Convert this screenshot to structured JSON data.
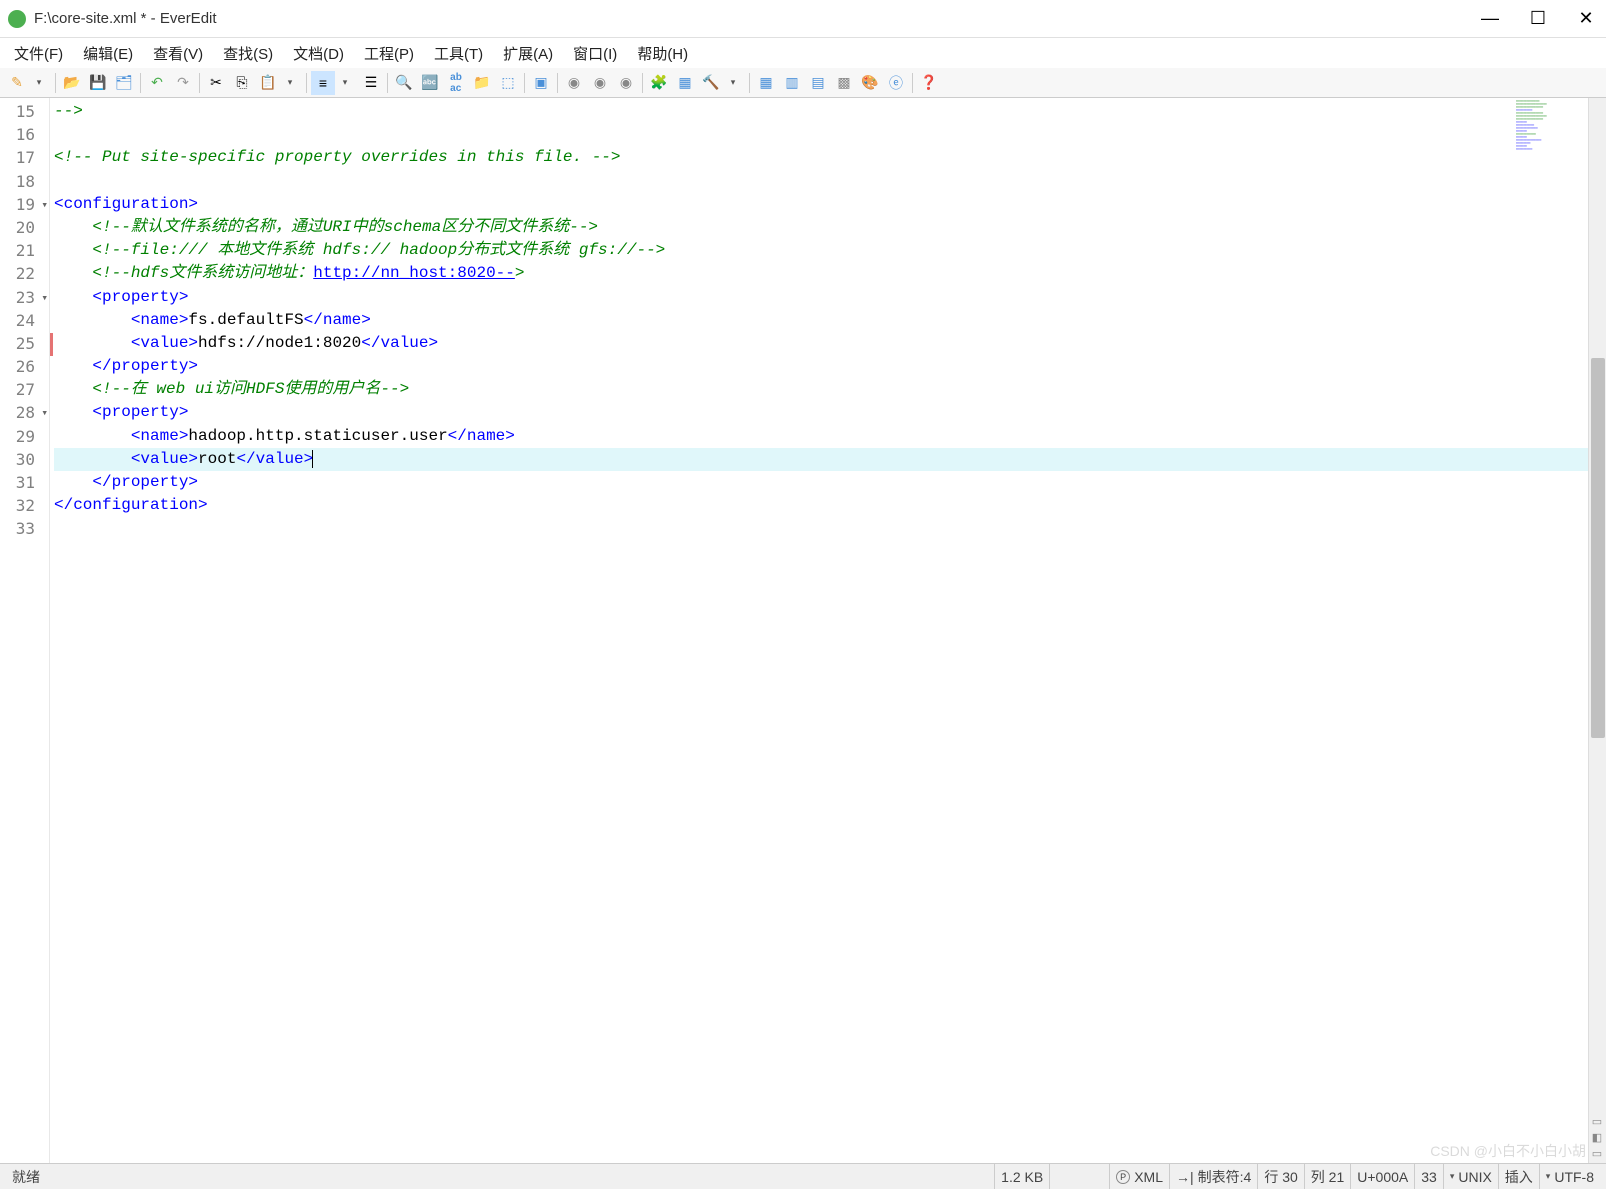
{
  "window": {
    "title": "F:\\core-site.xml * - EverEdit",
    "appname": "EverEdit"
  },
  "menu": {
    "items": [
      "文件(F)",
      "编辑(E)",
      "查看(V)",
      "查找(S)",
      "文档(D)",
      "工程(P)",
      "工具(T)",
      "扩展(A)",
      "窗口(I)",
      "帮助(H)"
    ]
  },
  "code": {
    "lines": [
      {
        "n": 15,
        "segs": [
          {
            "t": "-->",
            "c": "c-cmt"
          }
        ]
      },
      {
        "n": 16,
        "segs": []
      },
      {
        "n": 17,
        "segs": [
          {
            "t": "<!-- Put site-specific property overrides in this file. -->",
            "c": "c-cmt"
          }
        ]
      },
      {
        "n": 18,
        "segs": []
      },
      {
        "n": 19,
        "fold": true,
        "segs": [
          {
            "t": "<configuration>",
            "c": "c-tag"
          }
        ]
      },
      {
        "n": 20,
        "segs": [
          {
            "t": "    ",
            "c": ""
          },
          {
            "t": "<!--默认文件系统的名称，通过URI中的schema区分不同文件系统-->",
            "c": "c-cmt"
          }
        ]
      },
      {
        "n": 21,
        "segs": [
          {
            "t": "    ",
            "c": ""
          },
          {
            "t": "<!--file:/// 本地文件系统 hdfs:// hadoop分布式文件系统 gfs://-->",
            "c": "c-cmt"
          }
        ]
      },
      {
        "n": 22,
        "segs": [
          {
            "t": "    ",
            "c": ""
          },
          {
            "t": "<!--hdfs文件系统访问地址：",
            "c": "c-cmt"
          },
          {
            "t": "http://nn_host:8020--",
            "c": "c-lnk"
          },
          {
            "t": ">",
            "c": "c-cmt"
          }
        ]
      },
      {
        "n": 23,
        "fold": true,
        "segs": [
          {
            "t": "    ",
            "c": ""
          },
          {
            "t": "<property>",
            "c": "c-tag"
          }
        ]
      },
      {
        "n": 24,
        "segs": [
          {
            "t": "        ",
            "c": ""
          },
          {
            "t": "<name>",
            "c": "c-tag"
          },
          {
            "t": "fs.defaultFS",
            "c": "c-txt"
          },
          {
            "t": "</name>",
            "c": "c-tag"
          }
        ]
      },
      {
        "n": 25,
        "segs": [
          {
            "t": "        ",
            "c": ""
          },
          {
            "t": "<value>",
            "c": "c-tag"
          },
          {
            "t": "hdfs://node1:8020",
            "c": "c-txt"
          },
          {
            "t": "</value>",
            "c": "c-tag"
          }
        ]
      },
      {
        "n": 26,
        "segs": [
          {
            "t": "    ",
            "c": ""
          },
          {
            "t": "</property>",
            "c": "c-tag"
          }
        ]
      },
      {
        "n": 27,
        "segs": [
          {
            "t": "    ",
            "c": ""
          },
          {
            "t": "<!--在 web ui访问HDFS使用的用户名-->",
            "c": "c-cmt"
          }
        ]
      },
      {
        "n": 28,
        "fold": true,
        "segs": [
          {
            "t": "    ",
            "c": ""
          },
          {
            "t": "<property>",
            "c": "c-tag"
          }
        ]
      },
      {
        "n": 29,
        "segs": [
          {
            "t": "        ",
            "c": ""
          },
          {
            "t": "<name>",
            "c": "c-tag"
          },
          {
            "t": "hadoop.http.staticuser.user",
            "c": "c-txt"
          },
          {
            "t": "</name>",
            "c": "c-tag"
          }
        ]
      },
      {
        "n": 30,
        "hl": true,
        "caret": true,
        "segs": [
          {
            "t": "        ",
            "c": ""
          },
          {
            "t": "<value>",
            "c": "c-tag"
          },
          {
            "t": "root",
            "c": "c-txt"
          },
          {
            "t": "</value>",
            "c": "c-tag"
          }
        ]
      },
      {
        "n": 31,
        "segs": [
          {
            "t": "    ",
            "c": ""
          },
          {
            "t": "</property>",
            "c": "c-tag"
          }
        ]
      },
      {
        "n": 32,
        "segs": [
          {
            "t": "</configuration>",
            "c": "c-tag"
          }
        ]
      },
      {
        "n": 33,
        "segs": []
      }
    ]
  },
  "status": {
    "ready": "就绪",
    "size": "1.2 KB",
    "lang": "XML",
    "tab": "制表符:4",
    "line": "行 30",
    "col": "列 21",
    "uni": "U+000A",
    "sel": "33",
    "eol": "UNIX",
    "mode": "插入",
    "enc": "UTF-8"
  },
  "watermark": "CSDN @小白不小白小胡",
  "icons": {
    "new": "📄",
    "open": "📂",
    "save": "💾",
    "saveall": "🗂",
    "undo": "↶",
    "redo": "↷",
    "cut": "✂",
    "copy": "📋",
    "paste": "📄",
    "wrap": "≡",
    "indent": "⇥",
    "list": "☰",
    "find": "🔍",
    "findtext": "🔤",
    "replace": "ab",
    "folder": "📁",
    "split": "▭",
    "window": "▣",
    "globe1": "🌐",
    "globe2": "🌐",
    "globe3": "🌐",
    "plugin": "🧩",
    "doc": "📘",
    "hammer": "🔨",
    "panel1": "▦",
    "panel2": "▥",
    "panel3": "▤",
    "panel4": "▩",
    "colors": "🎨",
    "ie": "🌐",
    "help": "❓"
  }
}
